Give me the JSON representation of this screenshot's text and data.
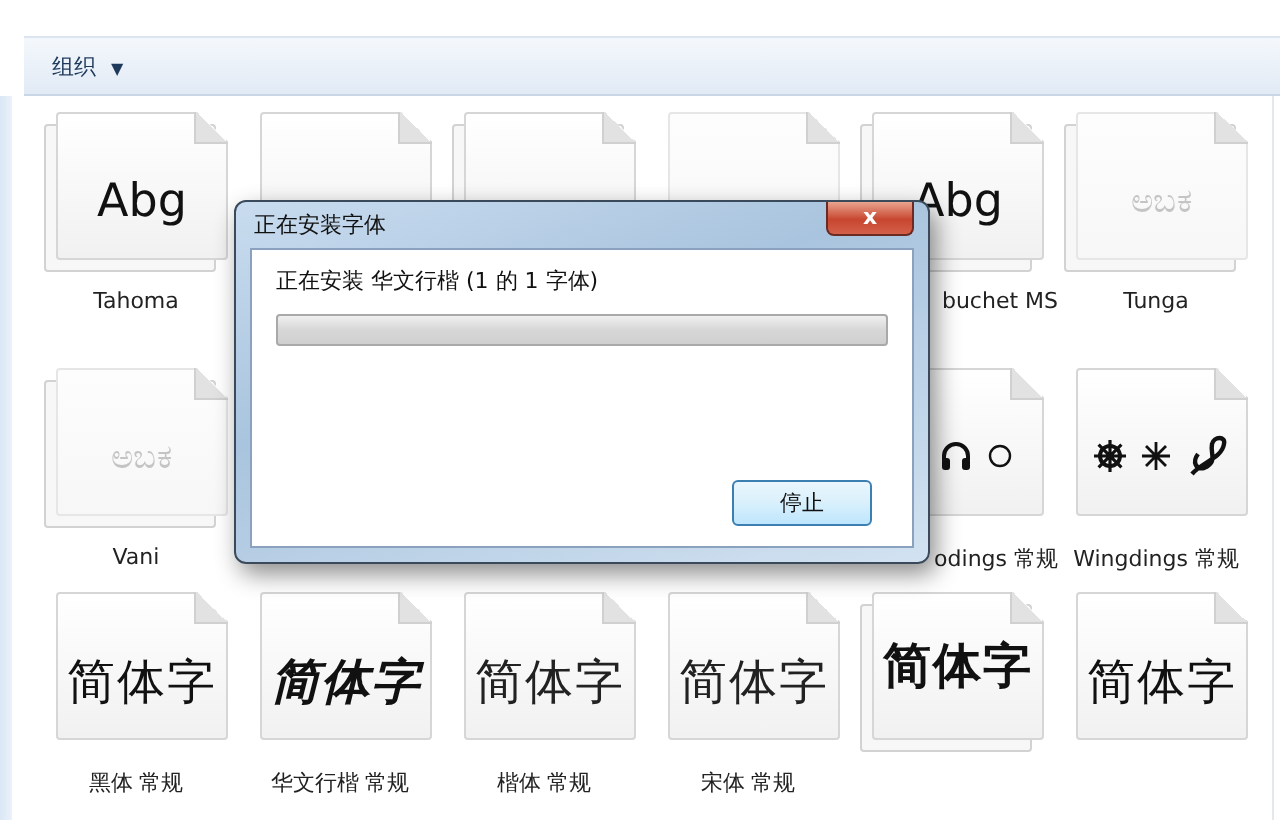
{
  "toolbar": {
    "organize": "组织",
    "caret": "▼"
  },
  "fonts": [
    {
      "kind": "latin",
      "sample": "Abg",
      "label": "Tahoma",
      "stacked": true,
      "faded": false
    },
    {
      "kind": "blank",
      "stacked": false
    },
    {
      "kind": "blank",
      "stacked": true
    },
    {
      "kind": "blank",
      "faded": true
    },
    {
      "kind": "latin",
      "sample": "Abg",
      "label": "buchet MS",
      "stacked": true,
      "faded": false
    },
    {
      "kind": "latin",
      "sample": "ಅಬಕ",
      "label": "Tunga",
      "stacked": true,
      "faded": true
    },
    {
      "kind": "latin",
      "sample": "ಅಬಕ",
      "label": "Vani",
      "stacked": true,
      "faded": true
    },
    {
      "kind": "covered"
    },
    {
      "kind": "covered"
    },
    {
      "kind": "covered"
    },
    {
      "kind": "webdings",
      "label": "odings 常规",
      "faded": false
    },
    {
      "kind": "wingdings",
      "label": "Wingdings 常规",
      "stacked": false,
      "faded": false
    },
    {
      "kind": "cjk",
      "sample": "简体字",
      "label": "黑体 常规",
      "stacked": false,
      "faded": false
    },
    {
      "kind": "cjk",
      "sample": "简体字",
      "label": "华文行楷 常规",
      "stacked": false,
      "faded": false
    },
    {
      "kind": "cjk",
      "sample": "简体字",
      "label": "楷体 常规",
      "stacked": false,
      "faded": false
    },
    {
      "kind": "cjk",
      "sample": "简体字",
      "label": "宋体 常规",
      "stacked": false,
      "faded": false
    },
    {
      "kind": "cjk",
      "sample": "简体字",
      "stacked": true,
      "faded": false
    },
    {
      "kind": "cjk",
      "sample": "简体字",
      "stacked": false,
      "faded": false
    }
  ],
  "dialog": {
    "title": "正在安装字体",
    "close": "x",
    "message": "正在安装 华文行楷 (1 的 1 字体)",
    "progress": {
      "level": 0
    },
    "buttons": [
      "停止"
    ]
  }
}
